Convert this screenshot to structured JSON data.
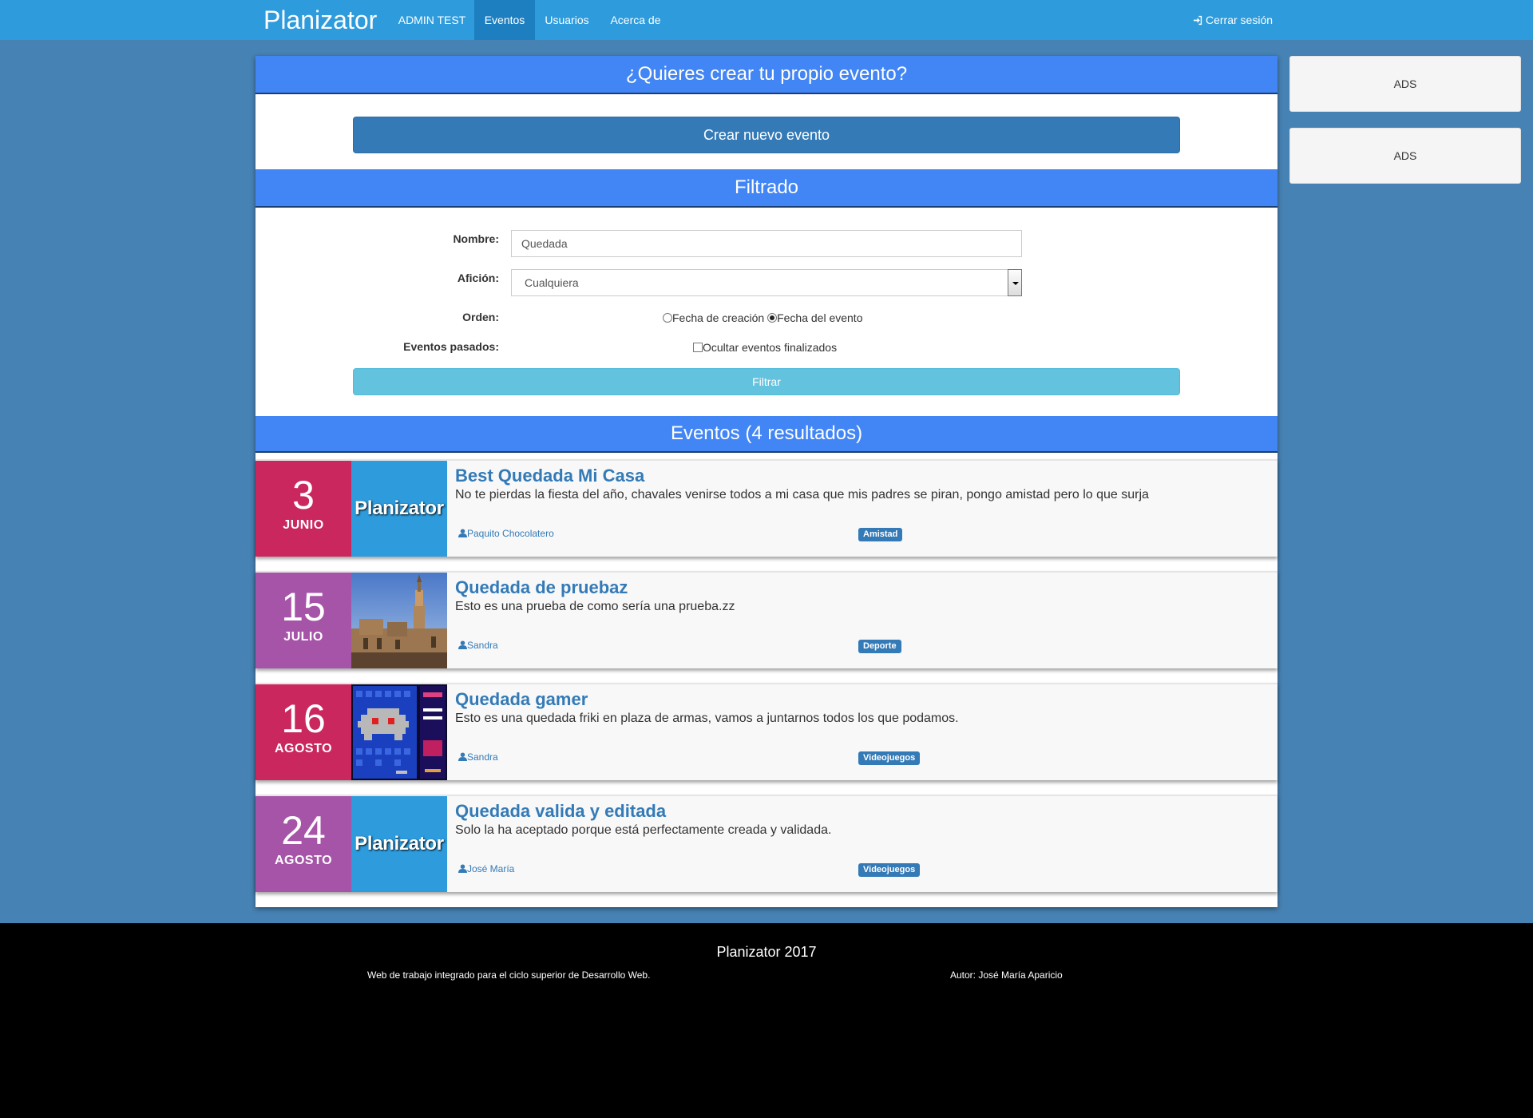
{
  "navbar": {
    "brand": "Planizator",
    "items": [
      {
        "label": "ADMIN TEST",
        "active": false
      },
      {
        "label": "Eventos",
        "active": true
      },
      {
        "label": "Usuarios",
        "active": false
      },
      {
        "label": "Acerca de",
        "active": false
      }
    ],
    "logout_label": "Cerrar sesión",
    "logout_icon": "log-in-icon",
    "color": "#2d9bdc"
  },
  "create_section": {
    "header": "¿Quieres crear tu propio evento?",
    "button_label": "Crear nuevo evento"
  },
  "filter_section": {
    "header": "Filtrado",
    "name_label": "Nombre:",
    "name_value": "Quedada",
    "hobby_label": "Afición:",
    "hobby_value": "Cualquiera",
    "order_label": "Orden:",
    "order_options": [
      {
        "label": "Fecha de creación",
        "checked": false
      },
      {
        "label": "Fecha del evento",
        "checked": true
      }
    ],
    "past_label": "Eventos pasados:",
    "past_checkbox_label": "Ocultar eventos finalizados",
    "past_checkbox_checked": false,
    "filter_button_label": "Filtrar"
  },
  "events_section": {
    "header": "Eventos (4 resultados)",
    "events": [
      {
        "day": "3",
        "month": "JUNIO",
        "date_color": "#c9275e",
        "thumbnail": "planizator-logo",
        "thumbnail_text": "Planizator",
        "title": "Best Quedada Mi Casa",
        "description": "No te pierdas la fiesta del año, chavales venirse todos a mi casa que mis padres se piran, pongo amistad pero lo que surja",
        "author": "Paquito Chocolatero",
        "tag": "Amistad"
      },
      {
        "day": "15",
        "month": "JULIO",
        "date_color": "#a654a8",
        "thumbnail": "cathedral-photo",
        "thumbnail_text": "",
        "title": "Quedada de pruebaz",
        "description": "Esto es una prueba de como sería una prueba.zz",
        "author": "Sandra",
        "tag": "Deporte"
      },
      {
        "day": "16",
        "month": "AGOSTO",
        "date_color": "#c9275e",
        "thumbnail": "arcade-game-screenshot",
        "thumbnail_text": "",
        "title": "Quedada gamer",
        "description": "Esto es una quedada friki en plaza de armas, vamos a juntarnos todos los que podamos.",
        "author": "Sandra",
        "tag": "Videojuegos"
      },
      {
        "day": "24",
        "month": "AGOSTO",
        "date_color": "#a654a8",
        "thumbnail": "planizator-logo",
        "thumbnail_text": "Planizator",
        "title": "Quedada valida y editada",
        "description": "Solo la ha aceptado porque está perfectamente creada y validada.",
        "author": "José María",
        "tag": "Videojuegos"
      }
    ]
  },
  "ads": [
    "ADS",
    "ADS"
  ],
  "footer": {
    "title": "Planizator 2017",
    "left": "Web de trabajo integrado para el ciclo superior de Desarrollo Web.",
    "right": "Autor: José María Aparicio"
  }
}
